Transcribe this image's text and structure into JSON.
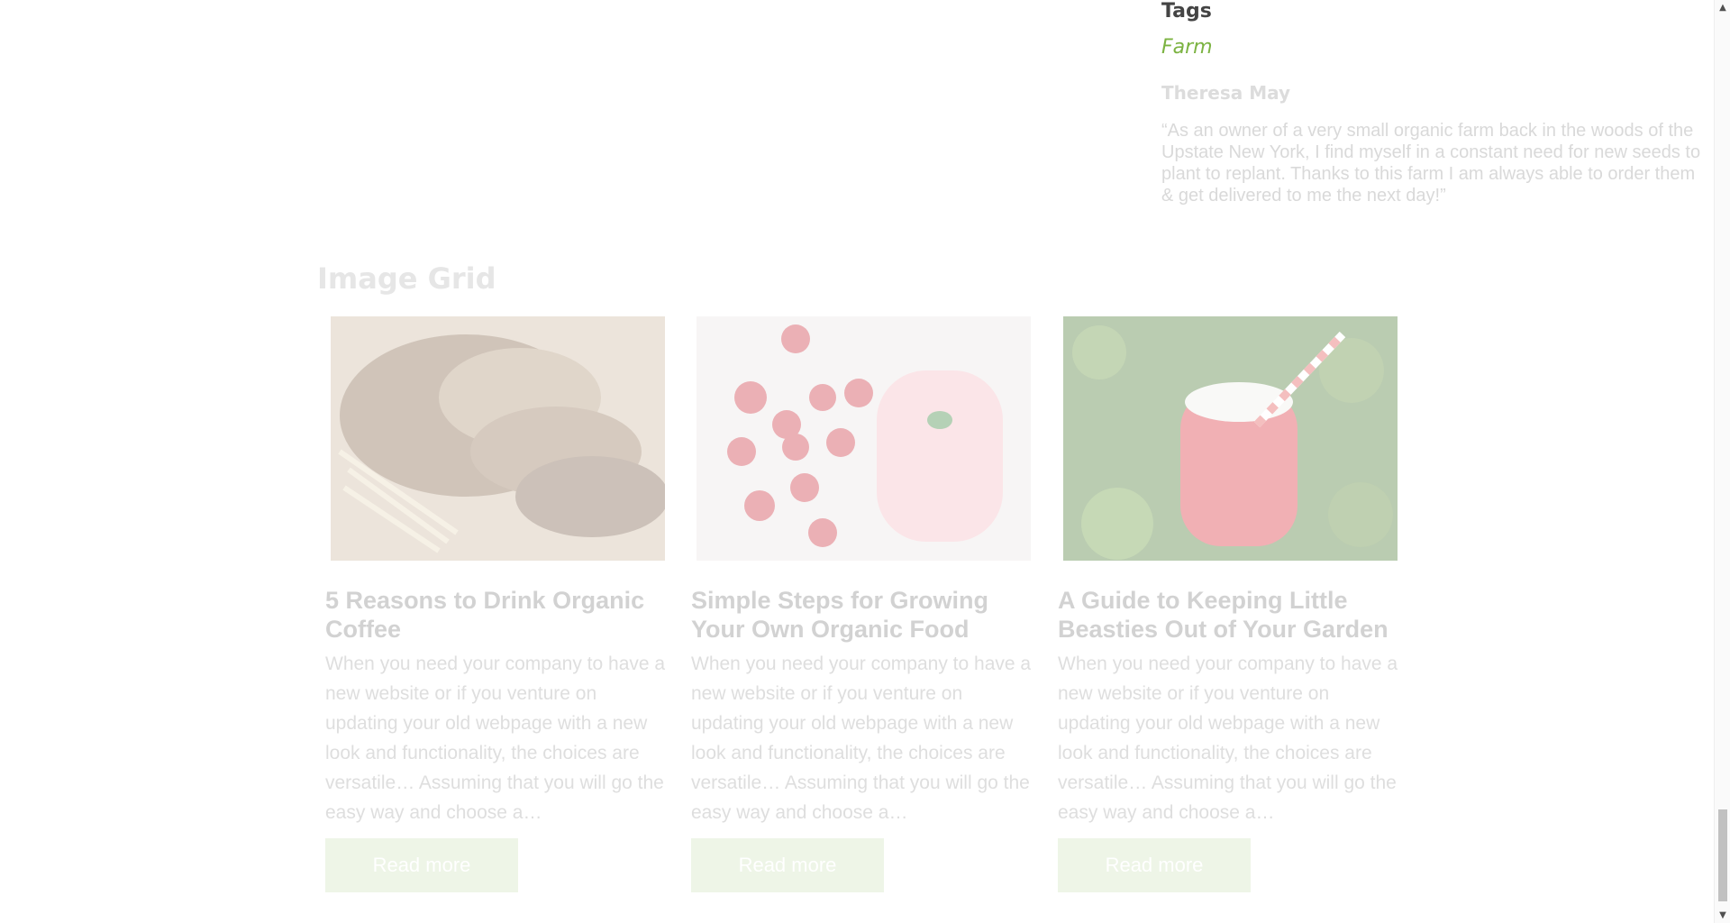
{
  "sidebar": {
    "tags_title": "Tags",
    "tag": "Farm",
    "testimonial_name": "Theresa May",
    "testimonial_quote": "“As an owner of a very small organic farm back in the woods of the Upstate New York, I find myself in a constant need for new seeds to plant to replant. Thanks to this farm I am always able to order them & get delivered to me the next day!”"
  },
  "image_grid": {
    "title": "Image Grid",
    "cards": [
      {
        "title": "5 Reasons to Drink Organic Coffee",
        "excerpt": "When you need your company to have a new website or if you venture on updating your old webpage with a new look and functionality, the choices are versatile… Assuming that you will go the easy way and choose a…",
        "button": "Read more",
        "image": "bread-image"
      },
      {
        "title": "Simple Steps for Growing Your Own Organic Food",
        "excerpt": "When you need your company to have a new website or if you venture on updating your old webpage with a new look and functionality, the choices are versatile… Assuming that you will go the easy way and choose a…",
        "button": "Read more",
        "image": "raspberry-smoothie-image"
      },
      {
        "title": "A Guide to Keeping Little Beasties Out of Your Garden",
        "excerpt": "When you need your company to have a new website or if you venture on updating your old webpage with a new look and functionality, the choices are versatile… Assuming that you will go the easy way and choose a…",
        "button": "Read more",
        "image": "juice-jar-image"
      }
    ]
  },
  "colors": {
    "tag_link": "#7cb342",
    "button_bg": "#eef5e7"
  }
}
